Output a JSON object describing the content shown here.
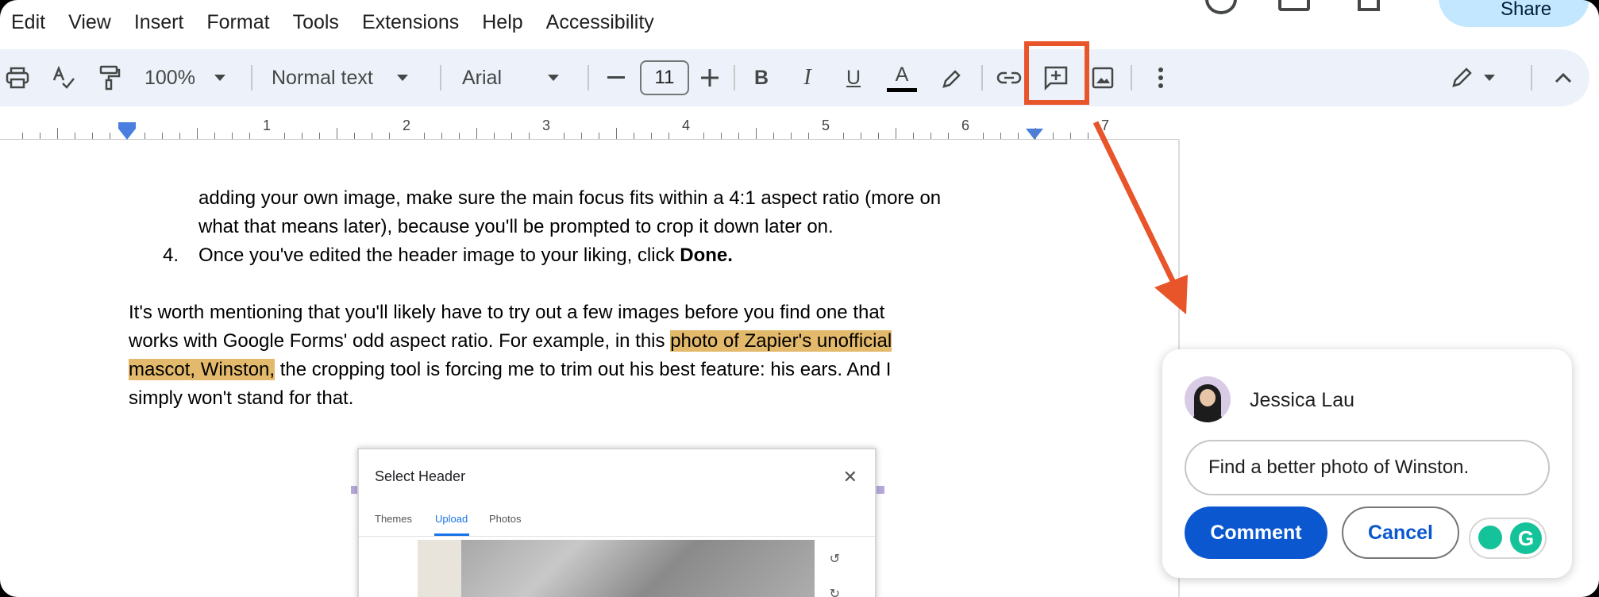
{
  "menu": [
    "Edit",
    "View",
    "Insert",
    "Format",
    "Tools",
    "Extensions",
    "Help",
    "Accessibility"
  ],
  "share_label": "Share",
  "toolbar": {
    "zoom": "100%",
    "style": "Normal text",
    "font": "Arial",
    "font_size": "11",
    "bold": "B",
    "italic": "I",
    "underline": "U",
    "text_color": "A",
    "text_color_hex": "#000000",
    "highlight_box_color": "#e8552a"
  },
  "ruler": {
    "numbers": [
      "1",
      "2",
      "3",
      "4",
      "5",
      "6",
      "7"
    ]
  },
  "document": {
    "list_continuation_1": "adding your own image, make sure the main focus fits within a 4:1 aspect ratio (more on",
    "list_continuation_2": "what that means later), because you'll be prompted to crop it down later on.",
    "item4_number": "4.",
    "item4_text": "Once you've edited the header image to your liking, click ",
    "item4_bold": "Done.",
    "para_line1": "It's worth mentioning that you'll likely have to try out a few images before you find one that",
    "para_line2_pre": "works with Google Forms' odd aspect ratio. For example, in this ",
    "para_line2_hl": "photo of Zapier's unofficial",
    "para_line3_hl": "mascot, Winston,",
    "para_line3_post": " the cropping tool is forcing me to trim out his best feature: his ears. And I",
    "para_line4": "simply won't stand for that.",
    "highlight_color": "#e3b96b"
  },
  "embed": {
    "title": "Select Header",
    "tabs": [
      "Themes",
      "Upload",
      "Photos"
    ],
    "active_tab": "Upload"
  },
  "comment_card": {
    "author": "Jessica Lau",
    "input_value": "Find a better photo of Winston.",
    "comment_button": "Comment",
    "cancel_button": "Cancel",
    "primary_color": "#0b57d0"
  },
  "annotation_arrow_color": "#e8552a"
}
